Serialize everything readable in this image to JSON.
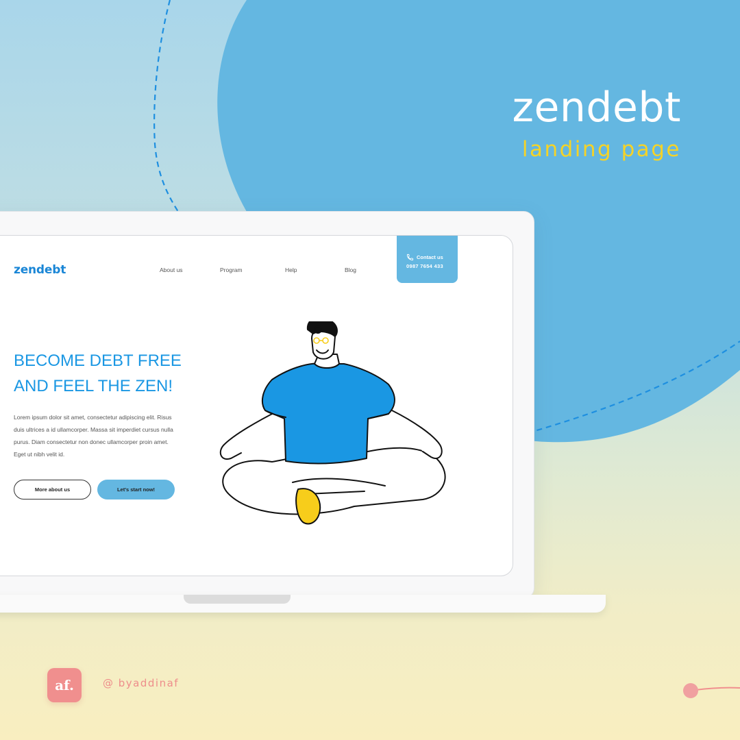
{
  "hero": {
    "title": "zendebt",
    "subtitle": "landing page"
  },
  "site": {
    "logo": "zendebt",
    "nav": [
      "About us",
      "Program",
      "Help",
      "Blog"
    ],
    "contact": {
      "label": "Contact us",
      "phone": "0987 7654 433",
      "icon": "phone-icon"
    },
    "headline": [
      "BECOME DEBT FREE",
      "AND FEEL THE ZEN!"
    ],
    "body": [
      "Lorem ipsum dolor sit amet, consectetur adipiscing elit. Risus",
      "duis ultrices a id ullamcorper. Massa sit imperdiet cursus nulla",
      "purus. Diam consectetur non donec ullamcorper proin amet.",
      "Eget ut nibh velit id."
    ],
    "buttons": {
      "primary_outline": "More about us",
      "primary_fill": "Let's start now!"
    }
  },
  "credit": {
    "badge": "af.",
    "handle": "@ byaddinaf"
  },
  "colors": {
    "blob": "#64b7e1",
    "accent_yellow": "#f5d327",
    "brand_blue": "#1a97e3",
    "coral": "#f08f8e"
  }
}
